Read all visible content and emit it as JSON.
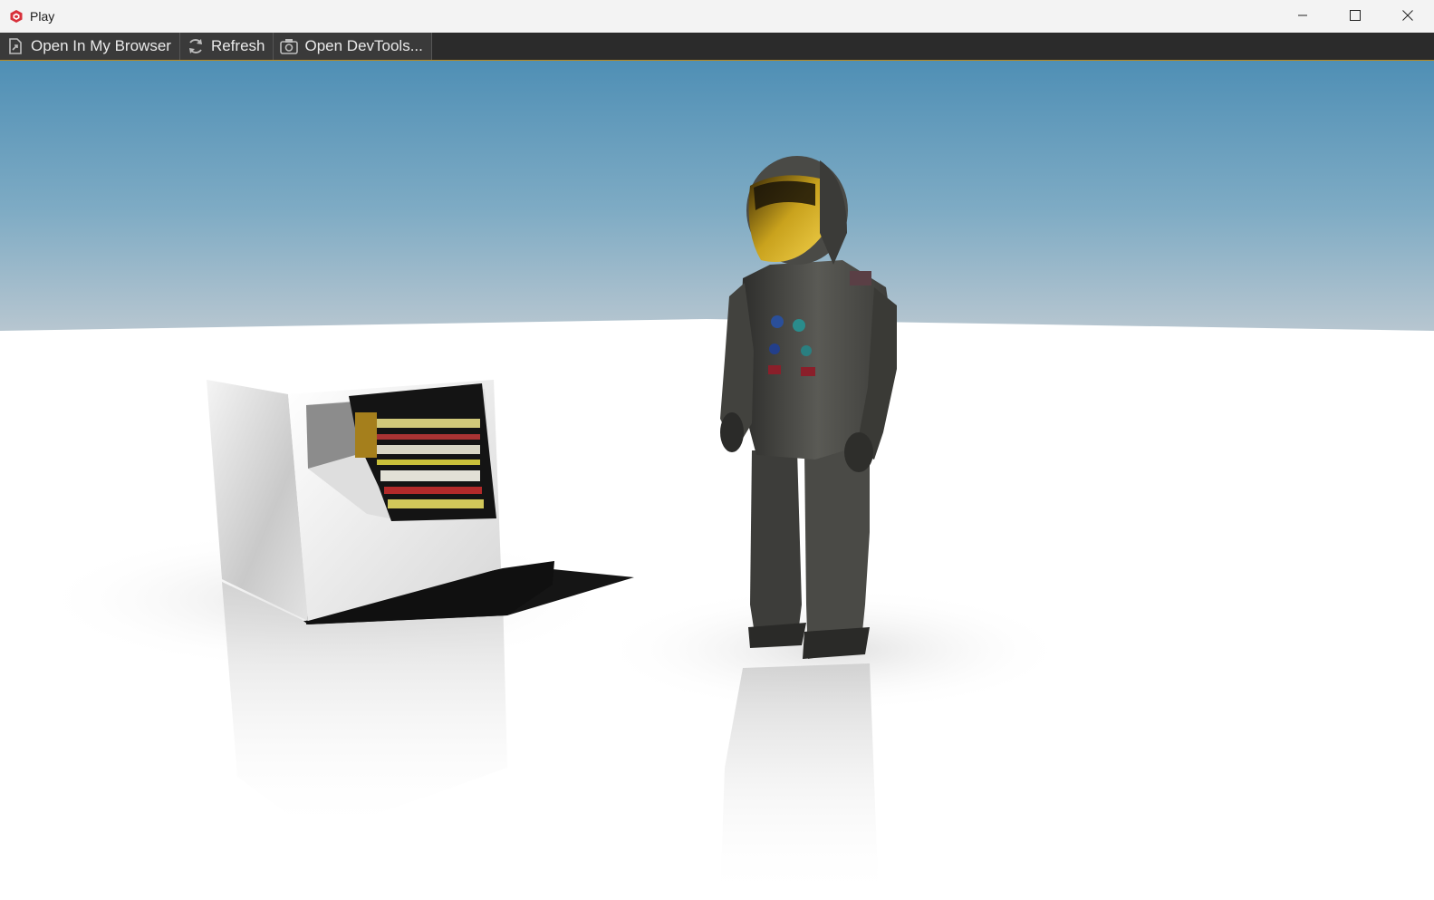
{
  "window": {
    "title": "Play",
    "icons": {
      "app": "playcanvas-logo-icon",
      "minimize": "minimize-icon",
      "maximize": "maximize-icon",
      "close": "close-icon"
    }
  },
  "toolbar": {
    "buttons": [
      {
        "label": "Open In My Browser",
        "icon": "open-external-icon"
      },
      {
        "label": "Refresh",
        "icon": "refresh-icon"
      },
      {
        "label": "Open DevTools...",
        "icon": "devtools-icon"
      }
    ]
  },
  "colors": {
    "toolbar_bg": "#2b2b2b",
    "toolbar_accent": "#b88a1e",
    "app_icon": "#d8303a",
    "sky_top": "#4f8fb5",
    "sky_horizon": "#b7c6d0",
    "ground": "#ffffff"
  }
}
